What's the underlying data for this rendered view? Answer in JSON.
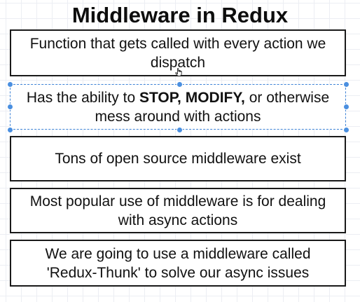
{
  "title": "Middleware in Redux",
  "boxes": [
    {
      "text": "Function that gets called with every action we dispatch"
    },
    {
      "text_prefix": "Has the ability to ",
      "emphasis": "STOP, MODIFY,",
      "text_suffix": " or otherwise mess around with actions"
    },
    {
      "text": "Tons of open source middleware exist"
    },
    {
      "text": "Most popular use of middleware is for dealing with async actions"
    },
    {
      "text": "We are going to use a middleware called 'Redux-Thunk' to solve our async issues"
    }
  ],
  "colors": {
    "selection": "#3d82d6",
    "handle": "#4a8fe0",
    "border": "#1a1a1a"
  },
  "icons": {
    "cursor": "hand-cursor-icon",
    "handle": "resize-handle-icon"
  }
}
